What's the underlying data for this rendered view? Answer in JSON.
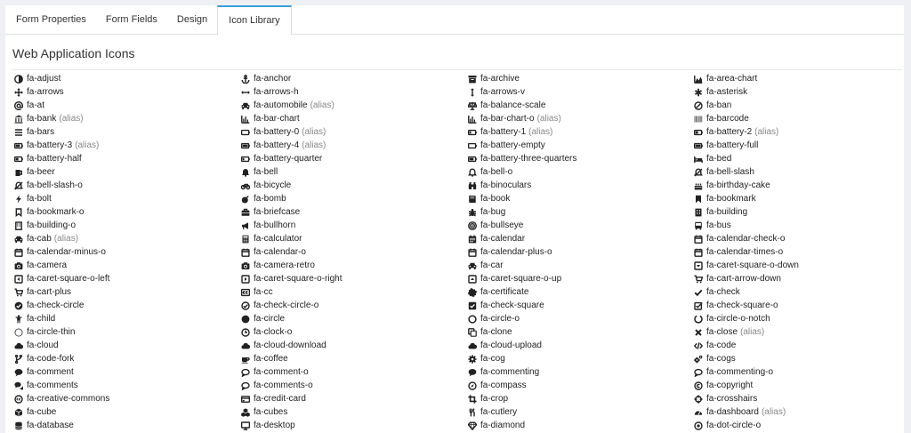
{
  "tabs": [
    {
      "id": "form-properties",
      "label": "Form Properties",
      "active": false
    },
    {
      "id": "form-fields",
      "label": "Form Fields",
      "active": false
    },
    {
      "id": "design",
      "label": "Design",
      "active": false
    },
    {
      "id": "icon-library",
      "label": "Icon Library",
      "active": true
    }
  ],
  "section": {
    "title": "Web Application Icons"
  },
  "alias_label": "(alias)",
  "colors": {
    "accent": "#3aa0d8",
    "text": "#222222",
    "muted": "#888888",
    "background": "#eef0f3"
  },
  "icons": [
    {
      "name": "fa-adjust",
      "icon": "adjust",
      "alias": false
    },
    {
      "name": "fa-anchor",
      "icon": "anchor",
      "alias": false
    },
    {
      "name": "fa-archive",
      "icon": "archive",
      "alias": false
    },
    {
      "name": "fa-area-chart",
      "icon": "area-chart",
      "alias": false
    },
    {
      "name": "fa-arrows",
      "icon": "arrows",
      "alias": false
    },
    {
      "name": "fa-arrows-h",
      "icon": "arrows-h",
      "alias": false
    },
    {
      "name": "fa-arrows-v",
      "icon": "arrows-v",
      "alias": false
    },
    {
      "name": "fa-asterisk",
      "icon": "asterisk",
      "alias": false
    },
    {
      "name": "fa-at",
      "icon": "at",
      "alias": false
    },
    {
      "name": "fa-automobile",
      "icon": "car",
      "alias": true
    },
    {
      "name": "fa-balance-scale",
      "icon": "balance-scale",
      "alias": false
    },
    {
      "name": "fa-ban",
      "icon": "ban",
      "alias": false
    },
    {
      "name": "fa-bank",
      "icon": "bank",
      "alias": true
    },
    {
      "name": "fa-bar-chart",
      "icon": "bar-chart",
      "alias": false
    },
    {
      "name": "fa-bar-chart-o",
      "icon": "bar-chart",
      "alias": true
    },
    {
      "name": "fa-barcode",
      "icon": "barcode",
      "alias": false
    },
    {
      "name": "fa-bars",
      "icon": "bars",
      "alias": false
    },
    {
      "name": "fa-battery-0",
      "icon": "battery-empty",
      "alias": true
    },
    {
      "name": "fa-battery-1",
      "icon": "battery-quarter",
      "alias": true
    },
    {
      "name": "fa-battery-2",
      "icon": "battery-half",
      "alias": true
    },
    {
      "name": "fa-battery-3",
      "icon": "battery-three-quarters",
      "alias": true
    },
    {
      "name": "fa-battery-4",
      "icon": "battery-full",
      "alias": true
    },
    {
      "name": "fa-battery-empty",
      "icon": "battery-empty",
      "alias": false
    },
    {
      "name": "fa-battery-full",
      "icon": "battery-full",
      "alias": false
    },
    {
      "name": "fa-battery-half",
      "icon": "battery-half",
      "alias": false
    },
    {
      "name": "fa-battery-quarter",
      "icon": "battery-quarter",
      "alias": false
    },
    {
      "name": "fa-battery-three-quarters",
      "icon": "battery-three-quarters",
      "alias": false
    },
    {
      "name": "fa-bed",
      "icon": "bed",
      "alias": false
    },
    {
      "name": "fa-beer",
      "icon": "beer",
      "alias": false
    },
    {
      "name": "fa-bell",
      "icon": "bell",
      "alias": false
    },
    {
      "name": "fa-bell-o",
      "icon": "bell-o",
      "alias": false
    },
    {
      "name": "fa-bell-slash",
      "icon": "bell-slash",
      "alias": false
    },
    {
      "name": "fa-bell-slash-o",
      "icon": "bell-slash",
      "alias": false
    },
    {
      "name": "fa-bicycle",
      "icon": "bicycle",
      "alias": false
    },
    {
      "name": "fa-binoculars",
      "icon": "binoculars",
      "alias": false
    },
    {
      "name": "fa-birthday-cake",
      "icon": "birthday-cake",
      "alias": false
    },
    {
      "name": "fa-bolt",
      "icon": "bolt",
      "alias": false
    },
    {
      "name": "fa-bomb",
      "icon": "bomb",
      "alias": false
    },
    {
      "name": "fa-book",
      "icon": "book",
      "alias": false
    },
    {
      "name": "fa-bookmark",
      "icon": "bookmark",
      "alias": false
    },
    {
      "name": "fa-bookmark-o",
      "icon": "bookmark-o",
      "alias": false
    },
    {
      "name": "fa-briefcase",
      "icon": "briefcase",
      "alias": false
    },
    {
      "name": "fa-bug",
      "icon": "bug",
      "alias": false
    },
    {
      "name": "fa-building",
      "icon": "building",
      "alias": false
    },
    {
      "name": "fa-building-o",
      "icon": "building-o",
      "alias": false
    },
    {
      "name": "fa-bullhorn",
      "icon": "bullhorn",
      "alias": false
    },
    {
      "name": "fa-bullseye",
      "icon": "bullseye",
      "alias": false
    },
    {
      "name": "fa-bus",
      "icon": "bus",
      "alias": false
    },
    {
      "name": "fa-cab",
      "icon": "car",
      "alias": true
    },
    {
      "name": "fa-calculator",
      "icon": "calculator",
      "alias": false
    },
    {
      "name": "fa-calendar",
      "icon": "calendar",
      "alias": false
    },
    {
      "name": "fa-calendar-check-o",
      "icon": "calendar-o",
      "alias": false
    },
    {
      "name": "fa-calendar-minus-o",
      "icon": "calendar-o",
      "alias": false
    },
    {
      "name": "fa-calendar-o",
      "icon": "calendar-o",
      "alias": false
    },
    {
      "name": "fa-calendar-plus-o",
      "icon": "calendar-o",
      "alias": false
    },
    {
      "name": "fa-calendar-times-o",
      "icon": "calendar-o",
      "alias": false
    },
    {
      "name": "fa-camera",
      "icon": "camera",
      "alias": false
    },
    {
      "name": "fa-camera-retro",
      "icon": "camera",
      "alias": false
    },
    {
      "name": "fa-car",
      "icon": "car",
      "alias": false
    },
    {
      "name": "fa-caret-square-o-down",
      "icon": "caret-square-down",
      "alias": false
    },
    {
      "name": "fa-caret-square-o-left",
      "icon": "caret-square-left",
      "alias": false
    },
    {
      "name": "fa-caret-square-o-right",
      "icon": "caret-square-right",
      "alias": false
    },
    {
      "name": "fa-caret-square-o-up",
      "icon": "caret-square-up",
      "alias": false
    },
    {
      "name": "fa-cart-arrow-down",
      "icon": "cart",
      "alias": false
    },
    {
      "name": "fa-cart-plus",
      "icon": "cart",
      "alias": false
    },
    {
      "name": "fa-cc",
      "icon": "cc",
      "alias": false
    },
    {
      "name": "fa-certificate",
      "icon": "certificate",
      "alias": false
    },
    {
      "name": "fa-check",
      "icon": "check",
      "alias": false
    },
    {
      "name": "fa-check-circle",
      "icon": "check-circle",
      "alias": false
    },
    {
      "name": "fa-check-circle-o",
      "icon": "check-circle-o",
      "alias": false
    },
    {
      "name": "fa-check-square",
      "icon": "check-square",
      "alias": false
    },
    {
      "name": "fa-check-square-o",
      "icon": "check-square-o",
      "alias": false
    },
    {
      "name": "fa-child",
      "icon": "child",
      "alias": false
    },
    {
      "name": "fa-circle",
      "icon": "circle",
      "alias": false
    },
    {
      "name": "fa-circle-o",
      "icon": "circle-o",
      "alias": false
    },
    {
      "name": "fa-circle-o-notch",
      "icon": "circle-o-notch",
      "alias": false
    },
    {
      "name": "fa-circle-thin",
      "icon": "circle-thin",
      "alias": false
    },
    {
      "name": "fa-clock-o",
      "icon": "clock-o",
      "alias": false
    },
    {
      "name": "fa-clone",
      "icon": "clone",
      "alias": false
    },
    {
      "name": "fa-close",
      "icon": "close",
      "alias": true
    },
    {
      "name": "fa-cloud",
      "icon": "cloud",
      "alias": false
    },
    {
      "name": "fa-cloud-download",
      "icon": "cloud",
      "alias": false
    },
    {
      "name": "fa-cloud-upload",
      "icon": "cloud",
      "alias": false
    },
    {
      "name": "fa-code",
      "icon": "code",
      "alias": false
    },
    {
      "name": "fa-code-fork",
      "icon": "code-fork",
      "alias": false
    },
    {
      "name": "fa-coffee",
      "icon": "coffee",
      "alias": false
    },
    {
      "name": "fa-cog",
      "icon": "cog",
      "alias": false
    },
    {
      "name": "fa-cogs",
      "icon": "cogs",
      "alias": false
    },
    {
      "name": "fa-comment",
      "icon": "comment",
      "alias": false
    },
    {
      "name": "fa-comment-o",
      "icon": "comment-o",
      "alias": false
    },
    {
      "name": "fa-commenting",
      "icon": "comment",
      "alias": false
    },
    {
      "name": "fa-commenting-o",
      "icon": "comment-o",
      "alias": false
    },
    {
      "name": "fa-comments",
      "icon": "comments",
      "alias": false
    },
    {
      "name": "fa-comments-o",
      "icon": "comment-o",
      "alias": false
    },
    {
      "name": "fa-compass",
      "icon": "compass",
      "alias": false
    },
    {
      "name": "fa-copyright",
      "icon": "copyright",
      "alias": false
    },
    {
      "name": "fa-creative-commons",
      "icon": "creative-commons",
      "alias": false
    },
    {
      "name": "fa-credit-card",
      "icon": "credit-card",
      "alias": false
    },
    {
      "name": "fa-crop",
      "icon": "crop",
      "alias": false
    },
    {
      "name": "fa-crosshairs",
      "icon": "crosshairs",
      "alias": false
    },
    {
      "name": "fa-cube",
      "icon": "cube",
      "alias": false
    },
    {
      "name": "fa-cubes",
      "icon": "cubes",
      "alias": false
    },
    {
      "name": "fa-cutlery",
      "icon": "cutlery",
      "alias": false
    },
    {
      "name": "fa-dashboard",
      "icon": "dashboard",
      "alias": true
    },
    {
      "name": "fa-database",
      "icon": "database",
      "alias": false
    },
    {
      "name": "fa-desktop",
      "icon": "desktop",
      "alias": false
    },
    {
      "name": "fa-diamond",
      "icon": "diamond",
      "alias": false
    },
    {
      "name": "fa-dot-circle-o",
      "icon": "dot-circle-o",
      "alias": false
    }
  ]
}
